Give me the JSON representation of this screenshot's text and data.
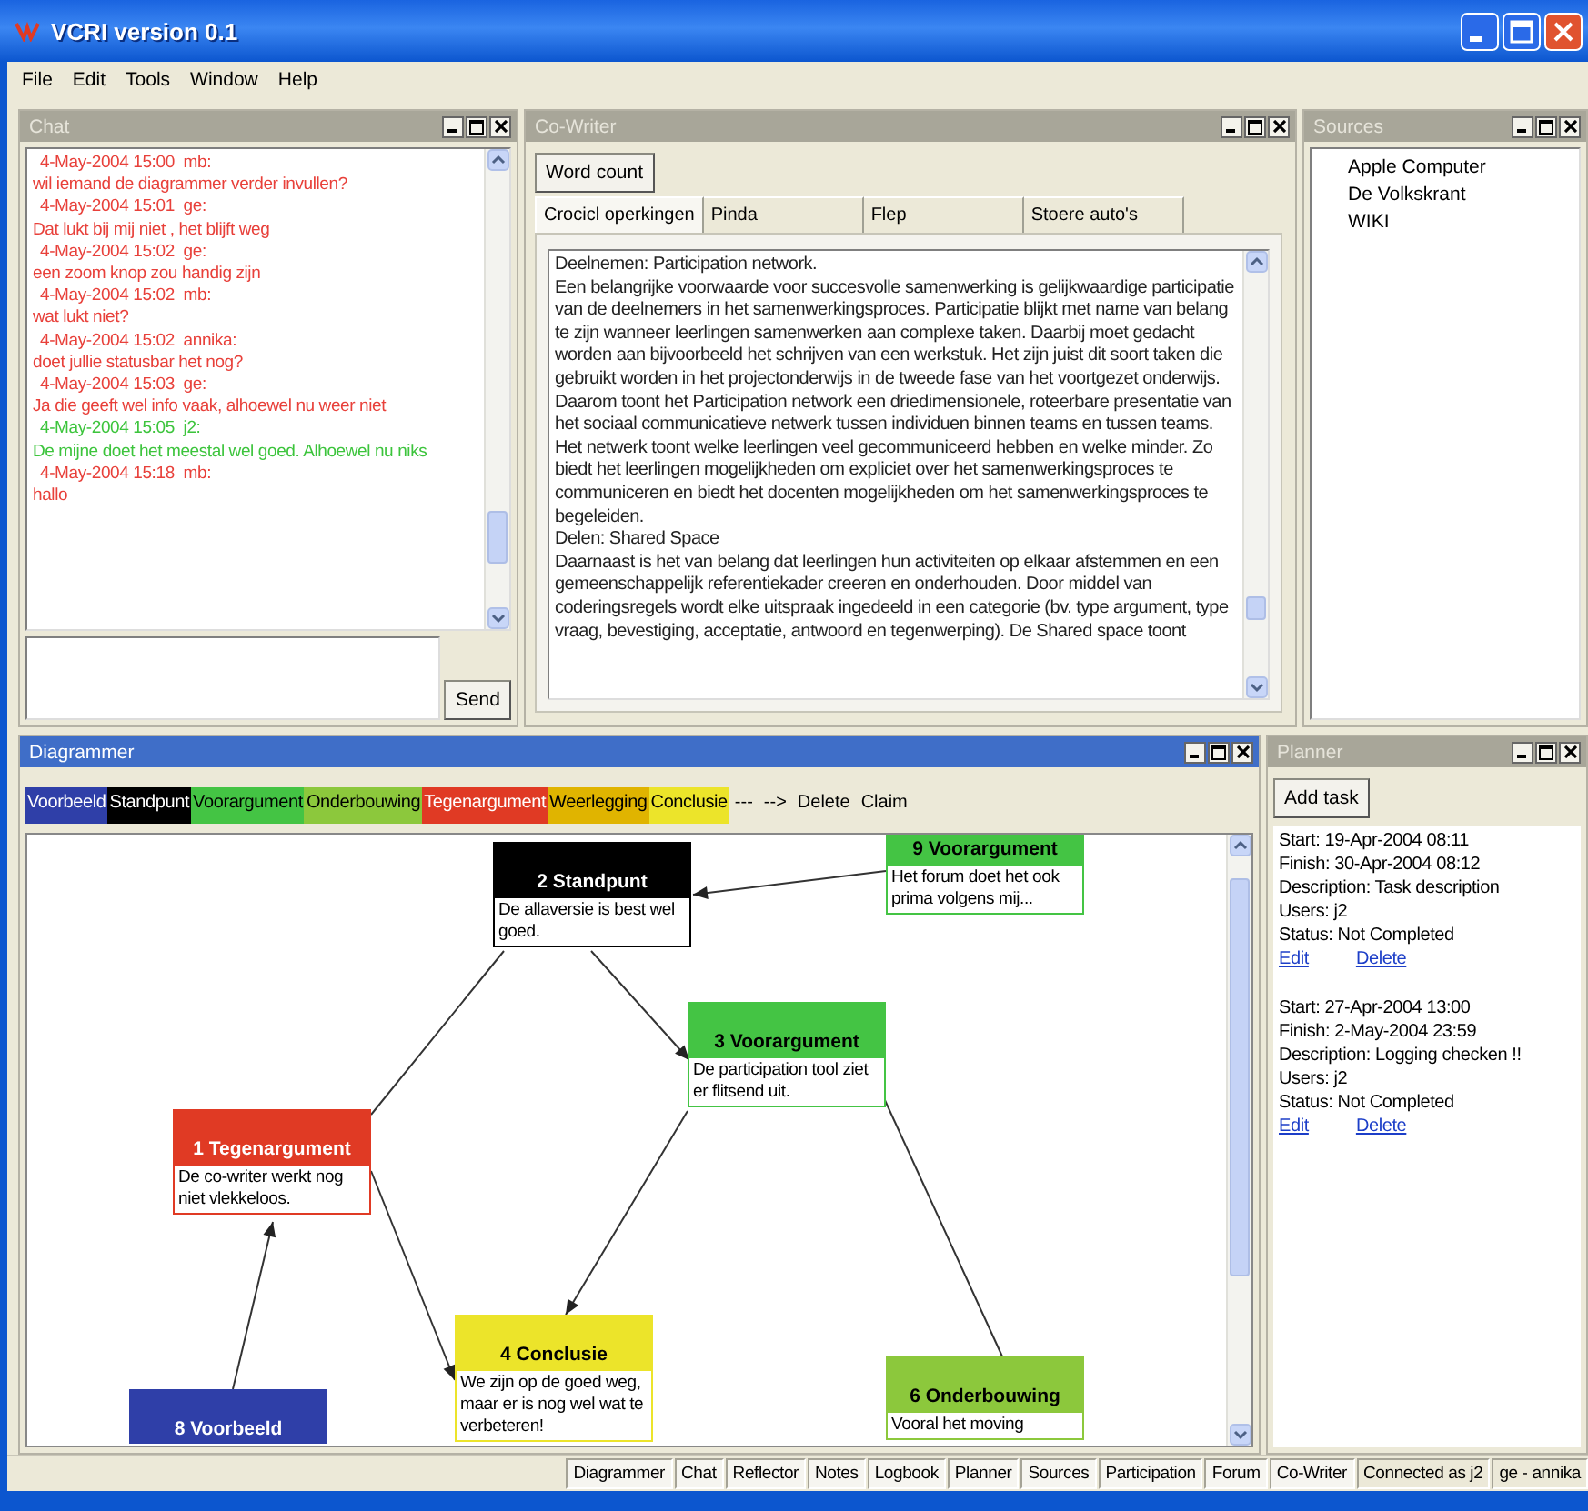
{
  "window": {
    "title": "VCRI version 0.1"
  },
  "menu": [
    "File",
    "Edit",
    "Tools",
    "Window",
    "Help"
  ],
  "chat": {
    "title": "Chat",
    "active": false,
    "send": "Send",
    "messages": [
      {
        "time": "4-May-2004 15:00",
        "user": "mb:",
        "text": "wil iemand de diagrammer verder invullen?",
        "color": "#e8403a"
      },
      {
        "time": "4-May-2004 15:01",
        "user": "ge:",
        "text": "Dat lukt bij mij niet , het blijft weg",
        "color": "#e8403a"
      },
      {
        "time": "4-May-2004 15:02",
        "user": "ge:",
        "text": "een zoom knop zou handig zijn",
        "color": "#e8403a"
      },
      {
        "time": "4-May-2004 15:02",
        "user": "mb:",
        "text": "wat lukt niet?",
        "color": "#e8403a"
      },
      {
        "time": "4-May-2004 15:02",
        "user": "annika:",
        "text": "doet jullie statusbar het nog?",
        "color": "#e8403a"
      },
      {
        "time": "4-May-2004 15:03",
        "user": "ge:",
        "text": "Ja die geeft wel info vaak, alhoewel nu weer niet",
        "color": "#e8403a"
      },
      {
        "time": "4-May-2004 15:05",
        "user": "j2:",
        "text": "De mijne doet het meestal wel goed. Alhoewel nu niks",
        "color": "#3cc43c"
      },
      {
        "time": "4-May-2004 15:18",
        "user": "mb:",
        "text": "hallo",
        "color": "#e8403a"
      }
    ]
  },
  "cowriter": {
    "title": "Co-Writer",
    "active": false,
    "word_count": "Word count",
    "tabs": [
      {
        "label": "Crocicl operkingen",
        "selected": true
      },
      {
        "label": "Pinda",
        "selected": false
      },
      {
        "label": "Flep",
        "selected": false
      },
      {
        "label": "Stoere auto's",
        "selected": false
      }
    ],
    "paragraphs": [
      "Deelnemen: Participation network.",
      "Een belangrijke voorwaarde voor succesvolle samenwerking is gelijkwaardige participatie van de deelnemers in het samenwerkingsproces. Participatie blijkt met name van belang te zijn wanneer leerlingen samenwerken aan complexe taken. Daarbij moet gedacht worden aan bijvoorbeeld het schrijven van een werkstuk. Het zijn juist dit soort taken die gebruikt worden in het projectonderwijs in de tweede fase van het voortgezet onderwijs. Daarom toont het Participation network een driedimensionele, roteerbare presentatie van het sociaal communicatieve netwerk tussen individuen binnen teams en tussen teams. Het netwerk toont welke leerlingen veel gecommuniceerd hebben en welke minder. Zo biedt het leerlingen mogelijkheden om expliciet over het samenwerkingsproces te communiceren en biedt het docenten mogelijkheden om het samenwerkingsproces te begeleiden.",
      "Delen: Shared Space",
      "Daarnaast is het van belang dat leerlingen hun activiteiten op elkaar afstemmen en een gemeenschappelijk referentiekader creeren en onderhouden. Door middel van coderingsregels wordt elke uitspraak ingedeeld in een categorie (bv. type argument, type vraag, bevestiging, acceptatie, antwoord en tegenwerping). De Shared space toont"
    ]
  },
  "sources": {
    "title": "Sources",
    "active": false,
    "items": [
      "Apple Computer",
      "De Volkskrant",
      "WIKI"
    ]
  },
  "diagrammer": {
    "title": "Diagrammer",
    "active": true,
    "palette": [
      {
        "label": "Voorbeeld",
        "color": "#2f3fa8"
      },
      {
        "label": "Standpunt",
        "color": "#000000"
      },
      {
        "label": "Voorargument",
        "color": "#44c444"
      },
      {
        "label": "Onderbouwing",
        "color": "#8cc83c"
      },
      {
        "label": "Tegenargument",
        "color": "#e03a24"
      },
      {
        "label": "Weerlegging",
        "color": "#e0b400"
      },
      {
        "label": "Conclusie",
        "color": "#ece42a"
      }
    ],
    "tools": [
      "---",
      "-->",
      "Delete",
      "Claim"
    ],
    "nodes": [
      {
        "title": "2 Standpunt",
        "text": "De allaversie is best wel goed.",
        "color": "#000000"
      },
      {
        "title": "9 Voorargument",
        "text": "Het forum doet het ook prima volgens mij...",
        "color": "#44c444"
      },
      {
        "title": "3 Voorargument",
        "text": "De participation tool  ziet er flitsend uit.",
        "color": "#44c444"
      },
      {
        "title": "1 Tegenargument",
        "text": "De co-writer werkt nog niet vlekkeloos.",
        "color": "#e03a24"
      },
      {
        "title": "8 Voorbeeld",
        "color": "#2f3fa8"
      },
      {
        "title": "4 Conclusie",
        "text": "We zijn op de goed weg, maar er is nog wel wat te verbeteren!",
        "color": "#ece42a"
      },
      {
        "title": "6 Onderbouwing",
        "text": "Vooral het moving",
        "color": "#8cc83c"
      }
    ],
    "links": [
      {
        "arrowhead": true
      },
      {
        "arrowhead": true
      },
      {
        "arrowhead": false
      },
      {
        "arrowhead": true
      },
      {
        "arrowhead": true
      },
      {
        "arrowhead": false
      },
      {
        "arrowhead": true
      }
    ]
  },
  "planner": {
    "title": "Planner",
    "active": false,
    "add_task": "Add task",
    "tasks": [
      {
        "lines": [
          "Start: 19-Apr-2004 08:11",
          "Finish: 30-Apr-2004 08:12",
          "Description: Task description",
          "Users: j2",
          "Status: Not Completed"
        ],
        "edit": "Edit",
        "delete": "Delete"
      },
      {
        "lines": [
          "Start: 27-Apr-2004 13:00",
          "Finish:  2-May-2004 23:59",
          "Description: Logging checken !!",
          "Users: j2",
          "Status: Not Completed"
        ],
        "edit": "Edit",
        "delete": "Delete"
      }
    ]
  },
  "status_bar": [
    {
      "label": "Diagrammer",
      "kind": "button"
    },
    {
      "label": "Chat",
      "kind": "button"
    },
    {
      "label": "Reflector",
      "kind": "button"
    },
    {
      "label": "Notes",
      "kind": "button"
    },
    {
      "label": "Logbook",
      "kind": "button"
    },
    {
      "label": "Planner",
      "kind": "button"
    },
    {
      "label": "Sources",
      "kind": "button"
    },
    {
      "label": "Participation",
      "kind": "button"
    },
    {
      "label": "Forum",
      "kind": "button"
    },
    {
      "label": "Co-Writer",
      "kind": "button"
    },
    {
      "label": "Connected as j2",
      "kind": "status"
    },
    {
      "label": "ge - annika",
      "kind": "status"
    }
  ]
}
